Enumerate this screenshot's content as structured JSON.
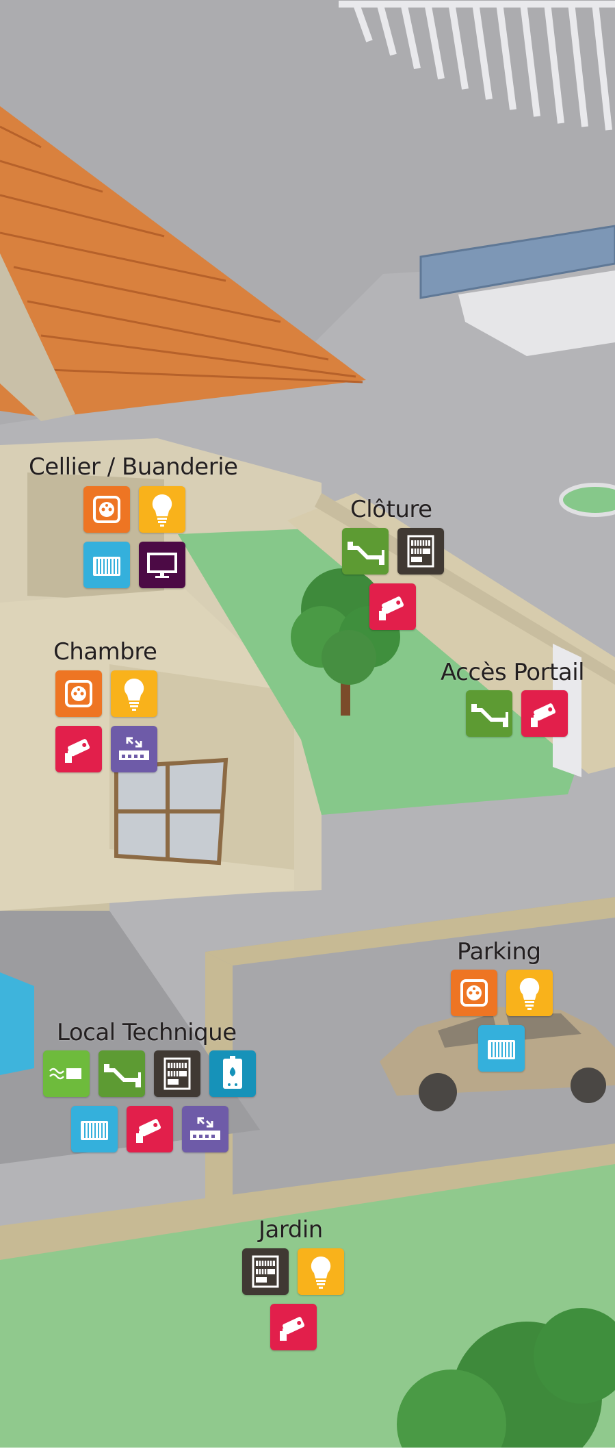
{
  "colors": {
    "prise": "#ee7523",
    "eclairage": "#f9b21b",
    "chauffage": "#34b0dc",
    "multimedia": "#4c0a45",
    "camera": "#e21f4b",
    "reseau": "#6e5ba8",
    "courant_porteur": "#5d9b33",
    "fibre": "#6ebb3c",
    "tableau": "#403933",
    "chaudiere": "#1692b9"
  },
  "rooms": {
    "cellier": {
      "label": "Cellier / Buanderie",
      "icons": [
        "outlet-icon",
        "light-bulb-icon",
        "radiator-icon",
        "tv-screen-icon"
      ]
    },
    "cloture": {
      "label": "Clôture",
      "icons": [
        "powerline-icon",
        "electrical-panel-icon",
        "security-camera-icon"
      ]
    },
    "chambre": {
      "label": "Chambre",
      "icons": [
        "outlet-icon",
        "light-bulb-icon",
        "security-camera-icon",
        "network-switch-icon"
      ]
    },
    "acces_portail": {
      "label": "Accès Portail",
      "icons": [
        "powerline-icon",
        "security-camera-icon"
      ]
    },
    "parking": {
      "label": "Parking",
      "icons": [
        "outlet-icon",
        "light-bulb-icon",
        "radiator-icon"
      ]
    },
    "local_technique": {
      "label": "Local Technique",
      "icons": [
        "fiber-modem-icon",
        "powerline-icon",
        "electrical-panel-icon",
        "boiler-icon",
        "radiator-icon",
        "security-camera-icon",
        "network-switch-icon"
      ]
    },
    "jardin": {
      "label": "Jardin",
      "icons": [
        "electrical-panel-icon",
        "light-bulb-icon",
        "security-camera-icon"
      ]
    }
  }
}
